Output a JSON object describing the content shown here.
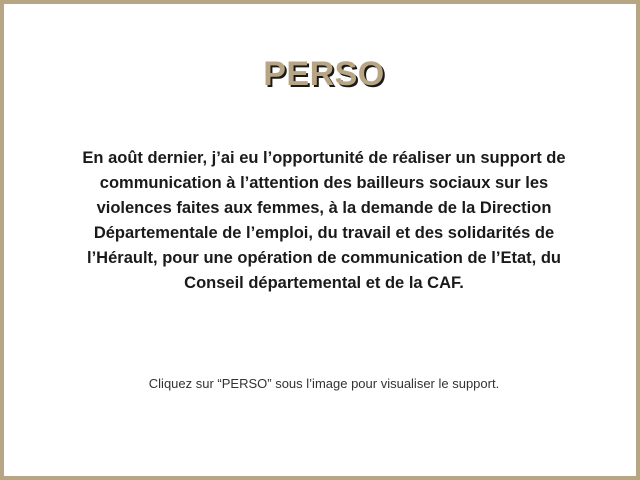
{
  "card": {
    "title": "PERSO",
    "description": "En août dernier, j’ai eu l’opportunité de réaliser un support de communication à l’attention des bailleurs sociaux sur les violences faites aux femmes, à la demande de la Direction Départementale de l’emploi, du travail et des solidarités de l’Hérault, pour une opération de communication de l’Etat, du Conseil départemental et de la CAF.",
    "note": "Cliquez sur “PERSO” sous l’image pour visualiser le support."
  },
  "colors": {
    "accent": "#b8a584",
    "text": "#1a1a1a"
  }
}
